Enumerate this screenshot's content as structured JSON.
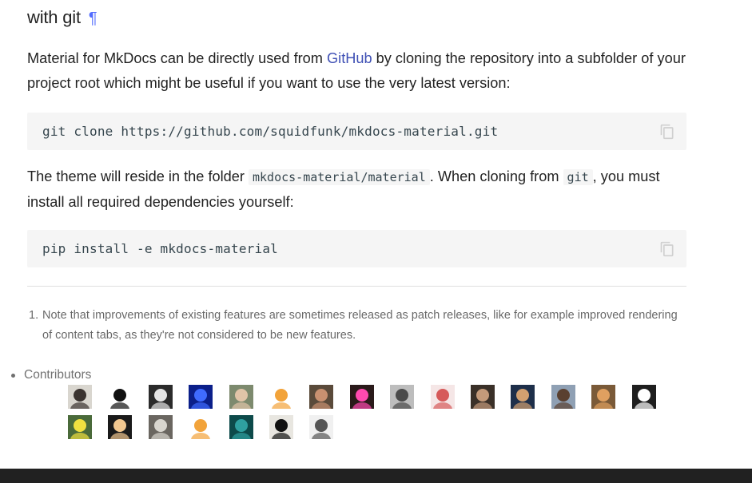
{
  "heading": {
    "text": "with git",
    "anchor": "¶"
  },
  "intro": {
    "before": "Material for MkDocs can be directly used from ",
    "link": "GitHub",
    "after": " by cloning the repository into a subfolder of your project root which might be useful if you want to use the very latest version:"
  },
  "code1": {
    "text": "git clone https://github.com/squidfunk/mkdocs-material.git"
  },
  "theme": {
    "part1": "The theme will reside in the folder ",
    "code_folder": "mkdocs-material/material",
    "part2": ". When cloning from ",
    "code_git": "git",
    "part3": ", you must install all required dependencies yourself:"
  },
  "code2": {
    "text": "pip install -e mkdocs-material"
  },
  "footnote": {
    "number": "1.",
    "text": "Note that improvements of existing features are sometimes released as patch releases, like for example improved rendering of content tabs, as they're not considered to be new features."
  },
  "contributors": {
    "label": "Contributors",
    "avatars": [
      {
        "color": "#d9d6cf",
        "accent": "#3a3330"
      },
      {
        "color": "#ffffff",
        "accent": "#111111"
      },
      {
        "color": "#2b2b2b",
        "accent": "#e6e6e6"
      },
      {
        "color": "#0b1f8a",
        "accent": "#3f6bff"
      },
      {
        "color": "#7d8a6e",
        "accent": "#e1c4a8"
      },
      {
        "color": "#ffffff",
        "accent": "#f2a33a"
      },
      {
        "color": "#5a4a3a",
        "accent": "#c89070"
      },
      {
        "color": "#2a1a1a",
        "accent": "#ff4ab0"
      },
      {
        "color": "#bdbdbd",
        "accent": "#4a4a4a"
      },
      {
        "color": "#f5e6e6",
        "accent": "#d65a5a"
      },
      {
        "color": "#3a3028",
        "accent": "#c49a7a"
      },
      {
        "color": "#1e2f4a",
        "accent": "#d2a070"
      },
      {
        "color": "#8fa0b4",
        "accent": "#5a4030"
      },
      {
        "color": "#7a5a38",
        "accent": "#e0a060"
      },
      {
        "color": "#1e1e1e",
        "accent": "#ffffff"
      },
      {
        "color": "#4a6a3a",
        "accent": "#f0e040"
      },
      {
        "color": "#1a1a1a",
        "accent": "#f2c890"
      },
      {
        "color": "#6a6660",
        "accent": "#d9d6cf"
      },
      {
        "color": "#ffffff",
        "accent": "#f2a33a"
      },
      {
        "color": "#0d4a4a",
        "accent": "#2fa0a0"
      },
      {
        "color": "#e8e6e0",
        "accent": "#111111"
      },
      {
        "color": "#f0f0f0",
        "accent": "#555555"
      }
    ]
  },
  "colors": {
    "link": "#4051b5",
    "anchor": "#526cfe",
    "code_bg": "#f5f5f5",
    "footer": "#212121"
  }
}
